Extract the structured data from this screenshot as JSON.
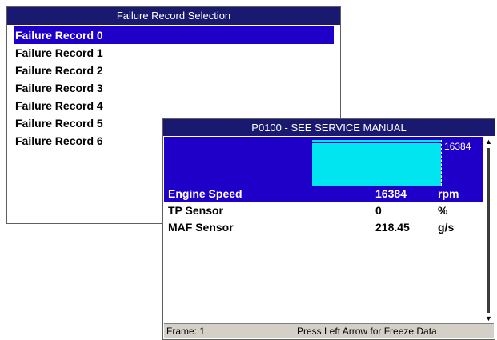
{
  "selection_window": {
    "title": "Failure Record Selection",
    "items": [
      {
        "label": "Failure Record 0",
        "selected": true
      },
      {
        "label": "Failure Record 1",
        "selected": false
      },
      {
        "label": "Failure Record 2",
        "selected": false
      },
      {
        "label": "Failure Record 3",
        "selected": false
      },
      {
        "label": "Failure Record 4",
        "selected": false
      },
      {
        "label": "Failure Record 5",
        "selected": false
      },
      {
        "label": "Failure Record 6",
        "selected": false
      }
    ]
  },
  "detail_window": {
    "title": "P0100 - SEE SERVICE MANUAL",
    "graph": {
      "max_label": "16384",
      "fill_fraction": 1.0
    },
    "params": [
      {
        "name": "Engine Speed",
        "value": "16384",
        "unit": "rpm",
        "selected": true
      },
      {
        "name": "TP Sensor",
        "value": "0",
        "unit": "%",
        "selected": false
      },
      {
        "name": "MAF Sensor",
        "value": "218.45",
        "unit": "g/s",
        "selected": false
      }
    ],
    "status": {
      "frame": "Frame: 1",
      "hint": "Press Left Arrow for Freeze Data"
    }
  },
  "colors": {
    "titlebar": "#191970",
    "selection": "#1e00c8",
    "graph_fill": "#00e5f0"
  }
}
